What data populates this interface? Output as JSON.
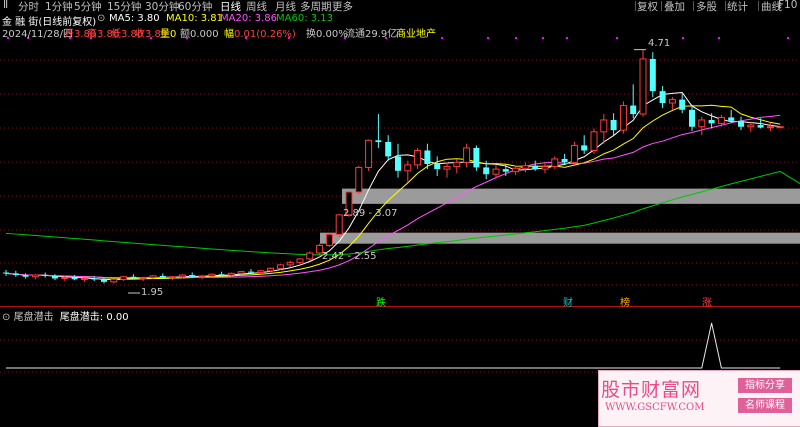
{
  "toolbar": {
    "tabs": [
      "Ⅱ",
      "分时",
      "1分钟",
      "5分钟",
      "15分钟",
      "30分钟",
      "60分钟",
      "日线",
      "周线",
      "月线",
      "多周期",
      "更多"
    ],
    "active_tab": "日线",
    "right_buttons": [
      "复权",
      "叠加",
      "多股",
      "统计",
      "曲线",
      "F10"
    ]
  },
  "header": {
    "stock_title": "金 融 街(日线前复权)",
    "ma5": "MA5: 3.80",
    "ma10": "MA10: 3.81",
    "ma20": "MA20: 3.86",
    "ma60": "MA60: 3.13",
    "date": "2024/11/28/四",
    "open_label": "开",
    "open_value": "3.80",
    "high_label": "高",
    "high_value": "3.80",
    "low_label": "低",
    "low_value": "3.80",
    "close_label": "收",
    "close_value": "3.80",
    "volume": "量0",
    "amount": "额0.000",
    "change_label": "幅",
    "change_value": "0.01(0.26%)",
    "turnover": "换0.00%",
    "float_cap": "流通29.9亿",
    "industry": "商业地产"
  },
  "annotations": {
    "high_mark": "4.71",
    "low_mark": "1.95",
    "band_upper": "2.89 - 3.07",
    "band_lower": "2.42 - 2.55",
    "events": [
      "跌",
      "财",
      "榜",
      "涨"
    ]
  },
  "indicator": {
    "title": "尾盘潜击",
    "name": "尾盘潜击:",
    "value": "0.00"
  },
  "watermark": {
    "logo": "股市财富网",
    "url": "WWW.GSCFW.COM",
    "tag1": "指标分享",
    "tag2": "名师课程"
  },
  "colors": {
    "up": "#ff3c3c",
    "down": "#54ffff",
    "ma5": "#ffffff",
    "ma10": "#ffff00",
    "ma20": "#ff55ff",
    "ma60": "#00c800",
    "background": "#000000"
  },
  "chart_data": {
    "type": "candlestick",
    "price_markers": {
      "high": 4.71,
      "low": 1.95
    },
    "bands": [
      {
        "low": 2.89,
        "high": 3.07
      },
      {
        "low": 2.42,
        "high": 2.55
      }
    ],
    "candles": [
      [
        2.08,
        2.11,
        2.04,
        2.07
      ],
      [
        2.07,
        2.1,
        2.03,
        2.05
      ],
      [
        2.05,
        2.07,
        2.01,
        2.03
      ],
      [
        2.03,
        2.06,
        2.0,
        2.05
      ],
      [
        2.05,
        2.08,
        2.02,
        2.04
      ],
      [
        2.04,
        2.06,
        1.99,
        2.01
      ],
      [
        2.01,
        2.04,
        1.98,
        2.02
      ],
      [
        2.02,
        2.05,
        1.99,
        2.0
      ],
      [
        2.0,
        2.03,
        1.97,
        2.01
      ],
      [
        2.01,
        2.04,
        1.98,
        2.0
      ],
      [
        2.0,
        2.02,
        1.95,
        1.97
      ],
      [
        1.97,
        2.01,
        1.95,
        2.0
      ],
      [
        2.0,
        2.04,
        1.98,
        2.03
      ],
      [
        2.03,
        2.06,
        2.0,
        2.01
      ],
      [
        2.01,
        2.03,
        1.98,
        2.02
      ],
      [
        2.02,
        2.05,
        2.0,
        2.04
      ],
      [
        2.04,
        2.07,
        2.01,
        2.02
      ],
      [
        2.02,
        2.04,
        1.99,
        2.03
      ],
      [
        2.03,
        2.06,
        2.01,
        2.05
      ],
      [
        2.05,
        2.08,
        2.02,
        2.03
      ],
      [
        2.03,
        2.05,
        2.0,
        2.04
      ],
      [
        2.04,
        2.07,
        2.02,
        2.06
      ],
      [
        2.06,
        2.09,
        2.03,
        2.05
      ],
      [
        2.05,
        2.08,
        2.03,
        2.07
      ],
      [
        2.07,
        2.1,
        2.05,
        2.09
      ],
      [
        2.09,
        2.12,
        2.06,
        2.08
      ],
      [
        2.08,
        2.11,
        2.06,
        2.1
      ],
      [
        2.1,
        2.14,
        2.08,
        2.13
      ],
      [
        2.13,
        2.18,
        2.11,
        2.17
      ],
      [
        2.17,
        2.22,
        2.14,
        2.2
      ],
      [
        2.2,
        2.25,
        2.17,
        2.24
      ],
      [
        2.24,
        2.33,
        2.22,
        2.31
      ],
      [
        2.31,
        2.42,
        2.28,
        2.4
      ],
      [
        2.4,
        2.55,
        2.38,
        2.53
      ],
      [
        2.53,
        2.77,
        2.5,
        2.76
      ],
      [
        2.76,
        3.04,
        2.74,
        3.03
      ],
      [
        3.03,
        3.34,
        3.0,
        3.32
      ],
      [
        3.32,
        3.65,
        3.28,
        3.64
      ],
      [
        3.64,
        3.95,
        3.55,
        3.62
      ],
      [
        3.62,
        3.7,
        3.4,
        3.45
      ],
      [
        3.45,
        3.6,
        3.2,
        3.28
      ],
      [
        3.28,
        3.4,
        3.15,
        3.35
      ],
      [
        3.35,
        3.55,
        3.3,
        3.52
      ],
      [
        3.52,
        3.6,
        3.3,
        3.36
      ],
      [
        3.36,
        3.45,
        3.22,
        3.3
      ],
      [
        3.3,
        3.38,
        3.2,
        3.33
      ],
      [
        3.33,
        3.42,
        3.25,
        3.38
      ],
      [
        3.38,
        3.6,
        3.32,
        3.55
      ],
      [
        3.55,
        3.58,
        3.28,
        3.32
      ],
      [
        3.32,
        3.4,
        3.18,
        3.24
      ],
      [
        3.24,
        3.35,
        3.2,
        3.3
      ],
      [
        3.3,
        3.36,
        3.22,
        3.27
      ],
      [
        3.27,
        3.34,
        3.23,
        3.31
      ],
      [
        3.31,
        3.38,
        3.26,
        3.34
      ],
      [
        3.34,
        3.4,
        3.28,
        3.3
      ],
      [
        3.3,
        3.37,
        3.25,
        3.33
      ],
      [
        3.33,
        3.45,
        3.3,
        3.42
      ],
      [
        3.42,
        3.48,
        3.35,
        3.38
      ],
      [
        3.38,
        3.62,
        3.35,
        3.58
      ],
      [
        3.58,
        3.7,
        3.48,
        3.52
      ],
      [
        3.52,
        3.78,
        3.48,
        3.74
      ],
      [
        3.74,
        3.95,
        3.6,
        3.88
      ],
      [
        3.88,
        3.96,
        3.7,
        3.76
      ],
      [
        3.76,
        4.1,
        3.72,
        4.05
      ],
      [
        4.05,
        4.3,
        3.9,
        3.95
      ],
      [
        3.95,
        4.71,
        3.92,
        4.6
      ],
      [
        4.6,
        4.68,
        4.15,
        4.22
      ],
      [
        4.22,
        4.28,
        4.02,
        4.08
      ],
      [
        4.08,
        4.15,
        4.0,
        4.12
      ],
      [
        4.12,
        4.2,
        3.96,
        4.0
      ],
      [
        4.0,
        4.06,
        3.75,
        3.8
      ],
      [
        3.8,
        3.92,
        3.7,
        3.88
      ],
      [
        3.88,
        3.96,
        3.78,
        3.84
      ],
      [
        3.84,
        3.94,
        3.8,
        3.91
      ],
      [
        3.91,
        4.0,
        3.84,
        3.87
      ],
      [
        3.87,
        3.92,
        3.76,
        3.8
      ],
      [
        3.8,
        3.86,
        3.74,
        3.82
      ],
      [
        3.82,
        3.9,
        3.78,
        3.79
      ],
      [
        3.79,
        3.85,
        3.75,
        3.8
      ],
      [
        3.8,
        3.8,
        3.8,
        3.8
      ]
    ],
    "indicator_values": [
      0,
      0,
      0,
      0,
      0,
      0,
      0,
      0,
      0,
      0,
      0,
      0,
      0,
      0,
      0,
      0,
      0,
      0,
      0,
      0,
      0,
      0,
      0,
      0,
      0,
      0,
      0,
      0,
      0,
      0,
      0,
      0,
      0,
      0,
      0,
      0,
      0,
      0,
      0,
      0,
      0,
      0,
      0,
      0,
      0,
      0,
      0,
      0,
      0,
      0,
      0,
      0,
      0,
      0,
      0,
      0,
      0,
      0,
      0,
      0,
      0,
      0,
      0,
      0,
      0,
      0,
      0,
      0,
      0,
      0,
      0,
      0,
      1,
      0,
      0,
      0,
      0,
      0,
      0,
      0
    ]
  }
}
